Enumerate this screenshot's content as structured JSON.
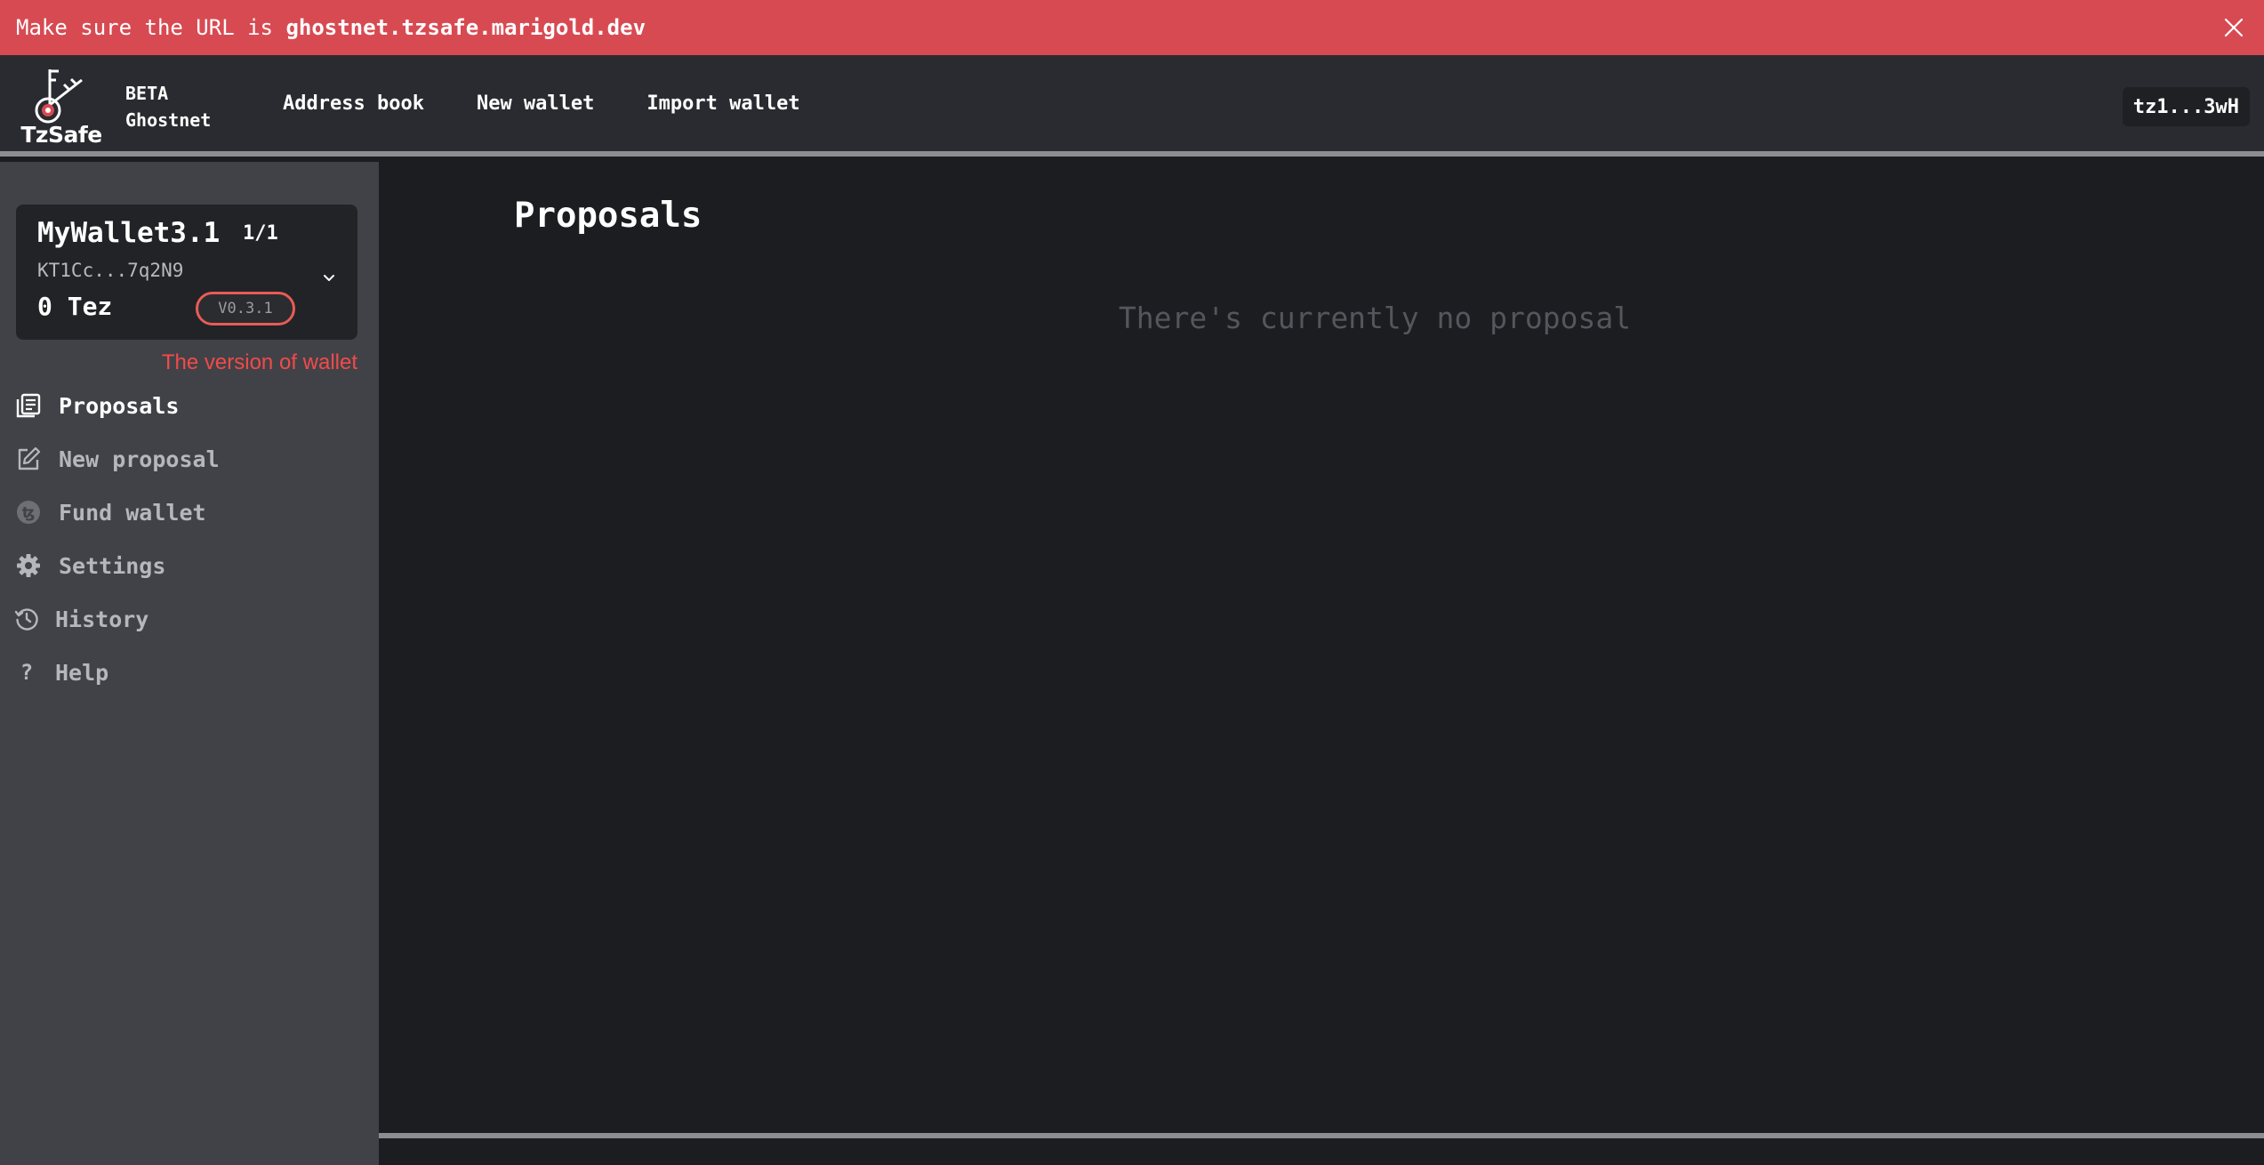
{
  "banner": {
    "lead": "Make sure the URL is ",
    "url": "ghostnet.tzsafe.marigold.dev",
    "close_icon": "close-icon"
  },
  "header": {
    "logo_text": "TzSafe",
    "badge": "BETA",
    "network": "Ghostnet",
    "nav": {
      "address_book": "Address book",
      "new_wallet": "New wallet",
      "import_wallet": "Import wallet"
    },
    "connected_address": "tz1...3wH"
  },
  "wallet": {
    "name": "MyWallet3.1",
    "threshold": "1/1",
    "address": "KT1Cc...7q2N9",
    "balance": "0 Tez",
    "version": "V0.3.1",
    "version_note": "The version of wallet"
  },
  "sidebar": {
    "items": [
      {
        "label": "Proposals",
        "icon": "proposals-icon",
        "active": true
      },
      {
        "label": "New proposal",
        "icon": "edit-icon",
        "active": false
      },
      {
        "label": "Fund wallet",
        "icon": "tez-coin-icon",
        "active": false
      },
      {
        "label": "Settings",
        "icon": "gear-icon",
        "active": false
      },
      {
        "label": "History",
        "icon": "history-icon",
        "active": false
      },
      {
        "label": "Help",
        "icon": "help-icon",
        "active": false
      }
    ]
  },
  "main": {
    "title": "Proposals",
    "empty_message": "There's currently no proposal"
  },
  "colors": {
    "banner": "#d84a52",
    "header": "#2a2b30",
    "sidebar": "#414247",
    "main": "#1c1d21",
    "version_highlight": "#e85c56",
    "note_text": "#f24a4a"
  }
}
